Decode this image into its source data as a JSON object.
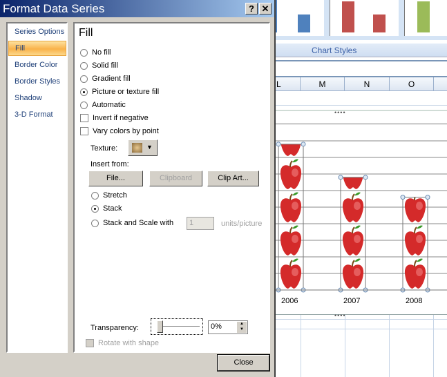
{
  "dialog": {
    "title": "Format Data Series",
    "help_label": "?",
    "close_x_label": "✕",
    "nav": [
      "Series Options",
      "Fill",
      "Border Color",
      "Border Styles",
      "Shadow",
      "3-D Format"
    ],
    "selected_nav": "Fill",
    "section_title": "Fill",
    "fill_options": [
      {
        "label": "No fill",
        "checked": false
      },
      {
        "label": "Solid fill",
        "checked": false
      },
      {
        "label": "Gradient fill",
        "checked": false
      },
      {
        "label": "Picture or texture fill",
        "checked": true
      },
      {
        "label": "Automatic",
        "checked": false
      }
    ],
    "checkboxes": [
      {
        "label": "Invert if negative",
        "checked": false
      },
      {
        "label": "Vary colors by point",
        "checked": false
      }
    ],
    "texture_label": "Texture:",
    "insert_from_label": "Insert from:",
    "file_button": "File...",
    "clipboard_button": "Clipboard",
    "clipart_button": "Clip Art...",
    "stretch_options": [
      {
        "label": "Stretch",
        "checked": false
      },
      {
        "label": "Stack",
        "checked": true
      },
      {
        "label": "Stack and Scale with",
        "checked": false
      }
    ],
    "units_value": "1",
    "units_label": "units/picture",
    "transparency_label": "Transparency:",
    "transparency_value": "0%",
    "transparency_percent": 0,
    "rotate_label": "Rotate with shape",
    "close_button": "Close"
  },
  "ribbon": {
    "chart_styles_label": "Chart Styles",
    "style_colors": [
      "#4f81bd",
      "#c0504d",
      "#9bbb59"
    ]
  },
  "sheet": {
    "columns": [
      "L",
      "M",
      "N",
      "O"
    ]
  },
  "chart": {
    "categories": [
      "2006",
      "2007",
      "2008"
    ],
    "pictures_per_bar": [
      4.4,
      3.4,
      2.8
    ],
    "bar_fill": "apple-picture"
  }
}
